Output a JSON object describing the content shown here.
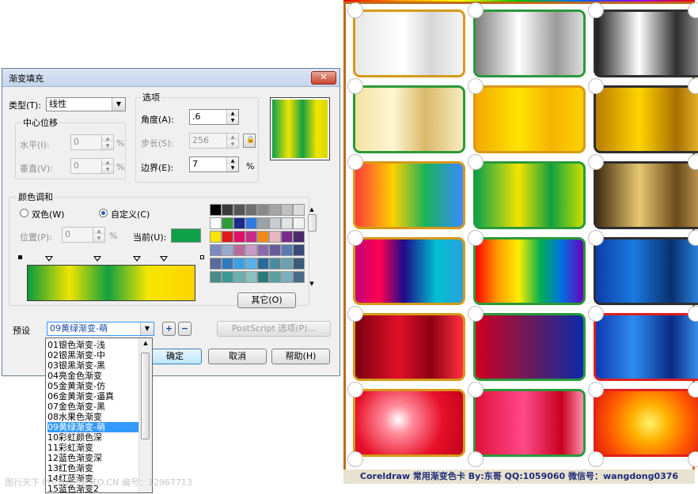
{
  "card": {
    "footer_text": "Coreldraw 常用渐变色卡 By:东哥 QQ:1059060 微信号：wangdong0376",
    "tiles": [
      {
        "name": "silver-light",
        "gradient": "linear-gradient(90deg,#e8e8e8,#ffffff 45%,#d6d6d6 70%,#f5f5f5)",
        "border": "#d69a1a"
      },
      {
        "name": "silver-mid",
        "gradient": "linear-gradient(90deg,#7d7d7d,#ffffff 40%,#9a9a9a 75%,#dcdcdc)",
        "border": "#2a9a3a"
      },
      {
        "name": "silver-dark",
        "gradient": "linear-gradient(90deg,#1e1e1e,#ffffff 40%,#2e2e2e 75%,#a0a0a0)",
        "border": "#2e2e2e"
      },
      {
        "name": "gold-pale",
        "gradient": "linear-gradient(90deg,#f4e2a4,#fff6d2 35%,#d9b96a 65%,#f8ebbf)",
        "border": "#2a9a3a"
      },
      {
        "name": "gold-bright",
        "gradient": "linear-gradient(90deg,#f3a800,#ffe400 40%,#f6b400 70%,#ffd000)",
        "border": "#d69a1a"
      },
      {
        "name": "gold-deep",
        "gradient": "linear-gradient(90deg,#b77c00,#ffd500 40%,#a86e00 75%,#f2c230)",
        "border": "#2e2e2e"
      },
      {
        "name": "fruit",
        "gradient": "linear-gradient(90deg,#ff3b3b,#ffd000 35%,#19b35a 65%,#3a8bff)",
        "border": "#d69a1a"
      },
      {
        "name": "yellow-green",
        "gradient": "linear-gradient(90deg,#0ba14b,#f5e400 40%,#10a040 70%,#c8e000)",
        "border": "#2a9a3a"
      },
      {
        "name": "bronze",
        "gradient": "linear-gradient(90deg,#3e2a10,#e8c870 40%,#6a4a18 75%,#c9a45a)",
        "border": "#2e2e2e"
      },
      {
        "name": "rainbow-dark",
        "gradient": "linear-gradient(90deg,#c2007a,#ff0050,#1e0a8a 45%,#00c0d0 75%,#2aa0e0)",
        "border": "#d69a1a"
      },
      {
        "name": "rainbow",
        "gradient": "linear-gradient(90deg,#ff0000,#ff9900,#ffee00,#00b050,#0070e0,#6a00c0)",
        "border": "#2a9a3a"
      },
      {
        "name": "blue-deep",
        "gradient": "linear-gradient(90deg,#0c3ea8,#1a7ae0 35%,#08306e 70%,#2e90ee)",
        "border": "#2e2e2e"
      },
      {
        "name": "red-deep",
        "gradient": "linear-gradient(90deg,#7a0010,#e0102a 40%,#8c0014 70%,#ff3040)",
        "border": "#d69a1a"
      },
      {
        "name": "red-blue",
        "gradient": "linear-gradient(90deg,#d00020,#6a1a5a 50%,#0c2aa8)",
        "border": "#2a9a3a"
      },
      {
        "name": "blue-wave",
        "gradient": "linear-gradient(90deg,#1038b0,#2e8cf0 35%,#0a2a86 70%,#40a0ff)",
        "border": "#e0201e"
      },
      {
        "name": "red-radial",
        "gradient": "radial-gradient(circle at 40% 45%,#ffffff 0%,#ff8a9a 20%,#e8102a 60%,#c0001a)",
        "border": "#d69a1a"
      },
      {
        "name": "pink-red",
        "gradient": "linear-gradient(90deg,#e0103a,#ff4a8a 45%,#c8001e 80%,#ff90b0)",
        "border": "#2a9a3a"
      },
      {
        "name": "orange-radial",
        "gradient": "radial-gradient(circle at 50% 50%,#fff46a 0%,#ffb000 30%,#ff5a00 65%,#e01a10)",
        "border": "#e0201e"
      }
    ]
  },
  "dialog": {
    "title": "渐变填充",
    "close_glyph": "✕",
    "type_label": "类型(T):",
    "type_value": "线性",
    "center_group": "中心位移",
    "horizontal_label": "水平(I):",
    "horizontal_value": "0",
    "vertical_label": "垂直(V):",
    "vertical_value": "0",
    "percent": "%",
    "options_group": "选项",
    "angle_label": "角度(A):",
    "angle_value": ".6",
    "steps_label": "步长(S):",
    "steps_value": "256",
    "edge_label": "边界(E):",
    "edge_value": "7",
    "blend_group": "颜色调和",
    "two_color_label": "双色(W)",
    "custom_label": "自定义(C)",
    "position_label": "位置(P):",
    "position_value": "0",
    "current_label": "当前(U):",
    "current_color": "#10a04a",
    "other_button": "其它(O)",
    "preset_label": "预设",
    "preset_value": "09黄绿渐变-萌",
    "postscript_button": "PostScript 选项(P)...",
    "ok_button": "确定",
    "cancel_button": "取消",
    "help_button": "帮助(H)",
    "preview_gradient": "linear-gradient(90deg,#0aa04a,#f2e400 30%,#12a040 55%,#f2e400 80%,#d8d800)",
    "bar_gradient": "linear-gradient(90deg,#0a9a3c,#f0e400 25%,#11a040 48%,#f5e600 72%,#ffd400)",
    "palette": [
      "#000000",
      "#3a3a3a",
      "#555555",
      "#707070",
      "#8a8a8a",
      "#a5a5a5",
      "#c0c0c0",
      "#dcdcdc",
      "#ffffff",
      "#2a9a3a",
      "#1e2a8a",
      "#2e7ae0",
      "#9aa3aa",
      "#c8ccd0",
      "#e0e4e8",
      "#f2f2f2",
      "#ffe400",
      "#e01a1a",
      "#e0106a",
      "#c82a8a",
      "#f08a1a",
      "#e8b8c0",
      "#7a2a8a",
      "#4a2a6a",
      "#7a8ac0",
      "#9aa8d0",
      "#b86a9a",
      "#c89ac8",
      "#8a6aa8",
      "#6a5a9a",
      "#5a7ab0",
      "#3a4a7a",
      "#5a6a9a",
      "#2e7ac0",
      "#3aa0e0",
      "#5ab0e8",
      "#2a6a9a",
      "#4a8aa0",
      "#6aa0b0",
      "#3a5a7a",
      "#4a8a8a",
      "#3a9a9a",
      "#6ab0b0",
      "#8ac0c0",
      "#2a7a7a",
      "#5aa0a0",
      "#7ab0c0",
      "#4a6a8a"
    ]
  },
  "dropdown": {
    "items": [
      "01银色渐变-浅",
      "02银黑渐变-中",
      "03银黑渐变-黑",
      "04亮金色渐变",
      "05金黄渐变-仿",
      "06金黄渐变-逼真",
      "07金色渐变-黑",
      "08水果色渐变",
      "09黄绿渐变-萌",
      "10彩虹颜色深",
      "11彩虹渐变",
      "12蓝色渐变深",
      "13红色渐变",
      "14红蓝渐变",
      "15蓝色渐变2"
    ],
    "selected_index": 8
  },
  "watermark": "图行天下 PHOTOPHOTO.CN   编号：12967713"
}
